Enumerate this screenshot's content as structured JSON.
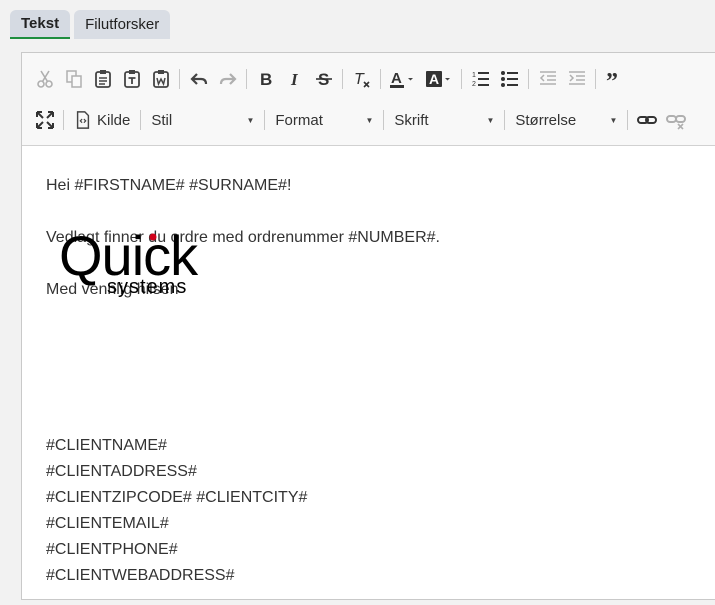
{
  "tabs": [
    {
      "label": "Tekst",
      "active": true
    },
    {
      "label": "Filutforsker",
      "active": false
    }
  ],
  "toolbar": {
    "source_label": "Kilde",
    "combos": [
      {
        "label": "Stil"
      },
      {
        "label": "Format"
      },
      {
        "label": "Skrift"
      },
      {
        "label": "Størrelse"
      }
    ]
  },
  "body": {
    "greeting": "Hei #FIRSTNAME# #SURNAME#!",
    "line2": "Vedlagt finner du ordre med ordrenummer #NUMBER#.",
    "closing": "Med vennlig hilsen",
    "logo_text": "Quick",
    "logo_sub": "systems",
    "client_lines": [
      "#CLIENTNAME#",
      "#CLIENTADDRESS#",
      "#CLIENTZIPCODE# #CLIENTCITY#",
      "#CLIENTEMAIL#",
      "#CLIENTPHONE#",
      "#CLIENTWEBADDRESS#"
    ]
  },
  "colors": {
    "tab_accent": "#1e8e3e",
    "logo_dot": "#d0021b"
  }
}
